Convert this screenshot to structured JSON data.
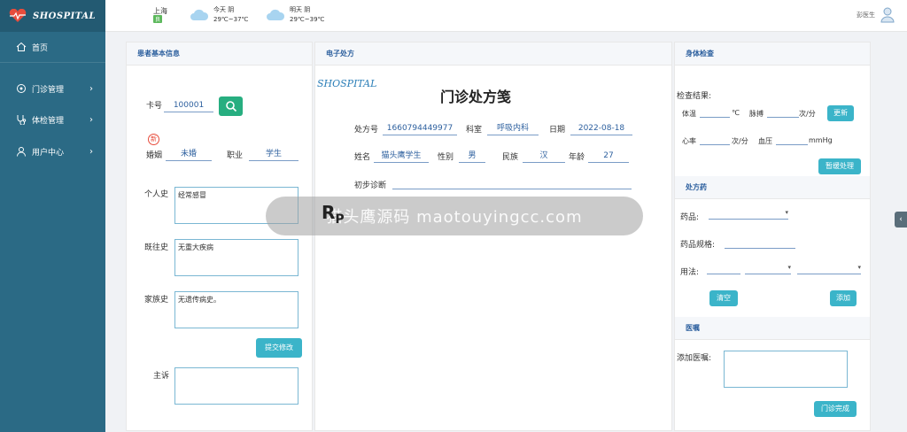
{
  "app": {
    "logo_text": "SHOSPITAL"
  },
  "sidebar": {
    "items": [
      {
        "label": "首页"
      },
      {
        "label": "门诊管理"
      },
      {
        "label": "体检管理"
      },
      {
        "label": "用户中心"
      }
    ]
  },
  "header": {
    "city": "上海",
    "city_badge": "良",
    "weather_today": {
      "day": "今天",
      "cond": "阴",
      "temp": "29℃~37℃"
    },
    "weather_tomorrow": {
      "day": "明天",
      "cond": "阴",
      "temp": "29℃~39℃"
    },
    "user": "彭医生"
  },
  "patient": {
    "title": "患者基本信息",
    "card_label": "卡号",
    "card_value": "100001",
    "new_badge": "新",
    "marital_label": "婚姻",
    "marital_value": "未婚",
    "job_label": "职业",
    "job_value": "学生",
    "personal_label": "个人史",
    "personal_value": "经常感冒",
    "past_label": "既往史",
    "past_value": "无重大疾病",
    "family_label": "家族史",
    "family_value": "无遗传病史。",
    "submit_label": "提交修改",
    "complaint_label": "主诉",
    "complaint_value": ""
  },
  "prescription": {
    "title": "电子处方",
    "script_logo": "SHOSPITAL",
    "main_title": "门诊处方笺",
    "no_label": "处方号",
    "no_value": "1660794449977",
    "dept_label": "科室",
    "dept_value": "呼吸内科",
    "date_label": "日期",
    "date_value": "2022-08-18",
    "name_label": "姓名",
    "name_value": "猫头鹰学生",
    "sex_label": "性别",
    "sex_value": "男",
    "ethnic_label": "民族",
    "ethnic_value": "汉",
    "age_label": "年龄",
    "age_value": "27",
    "diag_label": "初步诊断",
    "rp": "R",
    "rp_sub": "P",
    "watermark": "猫头鹰源码 maotouyingcc.com"
  },
  "exam": {
    "title": "身体检查",
    "result_label": "检查结果:",
    "temp_label": "体温",
    "temp_unit": "℃",
    "pulse_label": "脉搏",
    "pulse_unit": "次/分",
    "update_label": "更新",
    "hr_label": "心率",
    "hr_unit": "次/分",
    "bp_label": "血压",
    "bp_unit": "mmHg",
    "rx_process_label": "暂缓处理"
  },
  "drugs": {
    "title": "处方药",
    "drug_label": "药品:",
    "spec_label": "药品规格:",
    "usage_label": "用法:",
    "clear_label": "清空",
    "add_label": "添加"
  },
  "advice": {
    "title": "医嘱",
    "add_label": "添加医嘱:",
    "finish_label": "门诊完成"
  },
  "colors": {
    "sidebar": "#2b6a85",
    "accent": "#3bb4c9",
    "search_btn": "#27ae80"
  }
}
